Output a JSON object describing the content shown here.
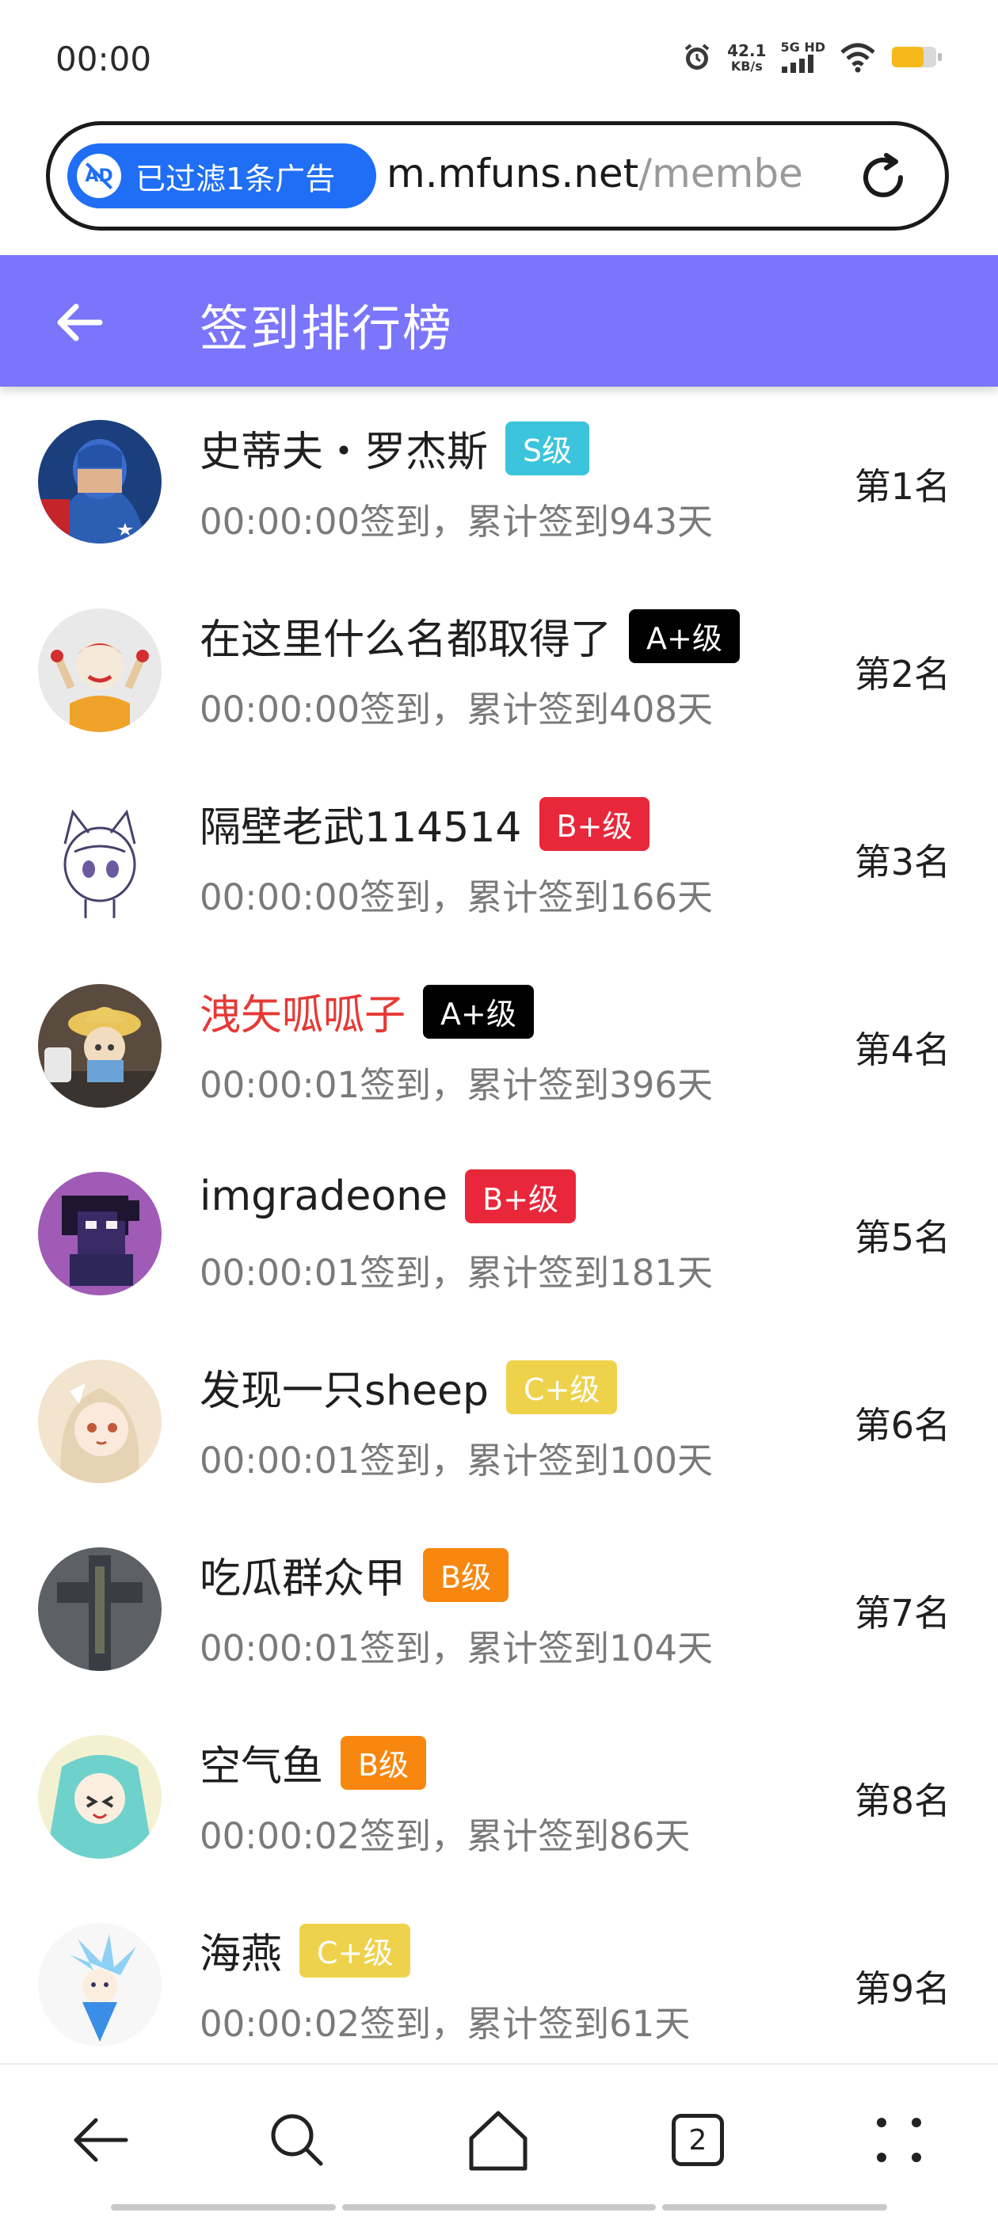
{
  "status_bar": {
    "time": "00:00",
    "net_speed_value": "42.1",
    "net_speed_unit": "KB/s",
    "network_label": "5G HD"
  },
  "address_bar": {
    "adblock_label": "已过滤1条广告",
    "ad_icon_text": "AD",
    "url_domain": "m.mfuns.net",
    "url_path": "/membe"
  },
  "header": {
    "title": "签到排行榜",
    "color": "#7a75fb"
  },
  "entries": [
    {
      "name": "史蒂夫・罗杰斯",
      "name_red": false,
      "level": "S级",
      "level_color": "#3cc4dc",
      "info": "00:00:00签到，累计签到943天",
      "rank": "第1名"
    },
    {
      "name": "在这里什么名都取得了",
      "name_red": false,
      "level": "A+级",
      "level_color": "#000000",
      "info": "00:00:00签到，累计签到408天",
      "rank": "第2名"
    },
    {
      "name": "隔壁老武114514",
      "name_red": false,
      "level": "B+级",
      "level_color": "#e8283a",
      "info": "00:00:00签到，累计签到166天",
      "rank": "第3名"
    },
    {
      "name": "洩矢呱呱子",
      "name_red": true,
      "level": "A+级",
      "level_color": "#000000",
      "info": "00:00:01签到，累计签到396天",
      "rank": "第4名"
    },
    {
      "name": "imgradeone",
      "name_red": false,
      "level": "B+级",
      "level_color": "#e8283a",
      "info": "00:00:01签到，累计签到181天",
      "rank": "第5名"
    },
    {
      "name": "发现一只sheep",
      "name_red": false,
      "level": "C+级",
      "level_color": "#efd24c",
      "info": "00:00:01签到，累计签到100天",
      "rank": "第6名"
    },
    {
      "name": "吃瓜群众甲",
      "name_red": false,
      "level": "B级",
      "level_color": "#f7870f",
      "info": "00:00:01签到，累计签到104天",
      "rank": "第7名"
    },
    {
      "name": "空气鱼",
      "name_red": false,
      "level": "B级",
      "level_color": "#f7870f",
      "info": "00:00:02签到，累计签到86天",
      "rank": "第8名"
    },
    {
      "name": "海燕",
      "name_red": false,
      "level": "C+级",
      "level_color": "#efd24c",
      "info": "00:00:02签到，累计签到61天",
      "rank": "第9名"
    }
  ],
  "bottom_nav": {
    "tab_count": "2"
  },
  "colors": {
    "accent": "#7a75fb",
    "adblock_blue": "#1f6ef5",
    "name_highlight": "#e53935"
  }
}
